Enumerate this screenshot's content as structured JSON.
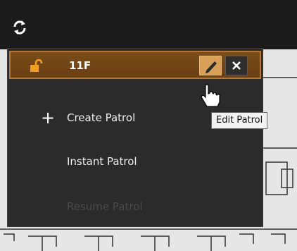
{
  "toolbar": {
    "sync_icon": "sync-icon"
  },
  "menu": {
    "header": {
      "title": "11F",
      "lock_icon": "unlock-icon",
      "edit_icon": "pencil-icon",
      "close_icon": "close-icon"
    },
    "items": [
      {
        "label": "Create Patrol",
        "icon": "plus-icon",
        "enabled": true
      },
      {
        "label": "Instant Patrol",
        "enabled": true
      },
      {
        "label": "Resume Patrol",
        "enabled": false
      }
    ]
  },
  "tooltip": {
    "text": "Edit Patrol"
  },
  "colors": {
    "header_bg": "#704414",
    "header_border": "#b8772e",
    "accent": "#f0a020",
    "menu_bg": "#2b2b2b"
  }
}
